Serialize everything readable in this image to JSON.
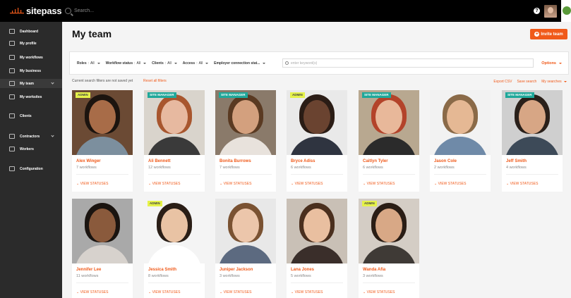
{
  "app": {
    "logo_text": "sitepass",
    "search_placeholder": "Search..."
  },
  "sidebar": {
    "items": [
      {
        "label": "Dashboard"
      },
      {
        "label": "My profile"
      },
      {
        "label": "My workflows"
      },
      {
        "label": "My business"
      },
      {
        "label": "My team"
      },
      {
        "label": "My worksites"
      },
      {
        "label": "Clients"
      },
      {
        "label": "Contractors"
      },
      {
        "label": "Workers"
      },
      {
        "label": "Configuration"
      }
    ]
  },
  "page": {
    "title": "My team",
    "invite_label": "Invite team"
  },
  "filters": {
    "items": [
      {
        "name": "Roles",
        "value": "All"
      },
      {
        "name": "Workflow status",
        "value": "All"
      },
      {
        "name": "Clients",
        "value": "All"
      },
      {
        "name": "Access",
        "value": "All"
      },
      {
        "name": "Employer connection stat...",
        "value": ""
      }
    ],
    "keyword_placeholder": "enter keyword(s)",
    "options_label": "Options"
  },
  "status_bar": {
    "note": "Current search filters are not saved yet",
    "reset": "Reset all filters",
    "export": "Export CSV",
    "save": "Save search",
    "my_searches": "My searches"
  },
  "members": [
    {
      "name": "Alex Winger",
      "workflows": "7 workflows",
      "badge": "ADMIN",
      "view": "VIEW STATUSES"
    },
    {
      "name": "Ali Bennett",
      "workflows": "12 workflows",
      "badge": "SITE MANAGER",
      "view": "VIEW STATUSES"
    },
    {
      "name": "Bonita Burrows",
      "workflows": "7 workflows",
      "badge": "SITE MANAGER",
      "view": "VIEW STATUSES"
    },
    {
      "name": "Bryce Adiss",
      "workflows": "6 workflows",
      "badge": "ADMIN",
      "view": "VIEW STATUSES"
    },
    {
      "name": "Caitlyn Tyler",
      "workflows": "6 workflows",
      "badge": "SITE MANAGER",
      "view": "VIEW STATUSES"
    },
    {
      "name": "Jason Cole",
      "workflows": "2 workflows",
      "badge": "",
      "view": "VIEW STATUSES"
    },
    {
      "name": "Jeff Smith",
      "workflows": "4 workflows",
      "badge": "SITE MANAGER",
      "view": "VIEW STATUSES"
    },
    {
      "name": "Jennifer Lee",
      "workflows": "11 workflows",
      "badge": "",
      "view": "VIEW STATUSES"
    },
    {
      "name": "Jessica Smith",
      "workflows": "8 workflows",
      "badge": "ADMIN",
      "view": "VIEW STATUSES"
    },
    {
      "name": "Juniper Jackson",
      "workflows": "3 workflows",
      "badge": "",
      "view": "VIEW STATUSES"
    },
    {
      "name": "Lana Jones",
      "workflows": "5 workflows",
      "badge": "",
      "view": "VIEW STATUSES"
    },
    {
      "name": "Wanda Afia",
      "workflows": "3 workflows",
      "badge": "ADMIN",
      "view": "VIEW STATUSES"
    }
  ],
  "colors": {
    "accent": "#f05a1a",
    "sidebar": "#2b2b2b",
    "topbar": "#000000",
    "admin_badge": "#e5f24a",
    "site_badge": "#1fa89a"
  }
}
